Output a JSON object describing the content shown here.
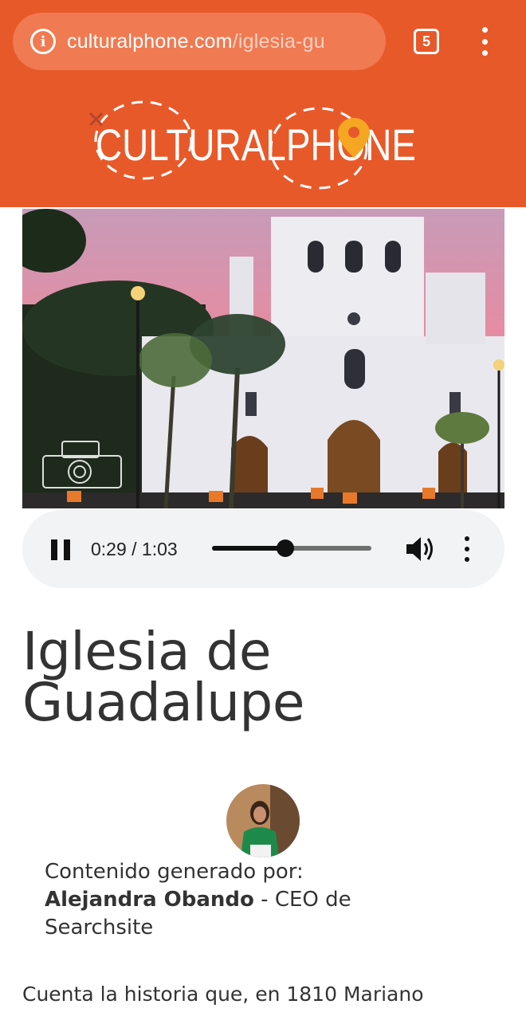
{
  "browser": {
    "url_host": "culturalphone.com",
    "url_path": "/iglesia-gu",
    "tab_count": "5"
  },
  "site": {
    "logo_text": "CULTURALPHONE",
    "brand_color": "#E8592A"
  },
  "player": {
    "time": "0:29 / 1:03",
    "progress": 0.46
  },
  "article": {
    "title": "Iglesia de Guadalupe",
    "author_prefix": "Contenido generado por:",
    "author_name": "Alejandra Obando",
    "author_role": " - CEO de Searchsite",
    "body_start": "Cuenta la historia que, en 1810 Mariano"
  },
  "icons": {
    "info": "info-circle-icon",
    "tabs": "tab-switcher-icon",
    "menu": "vertical-dots-icon",
    "pause": "pause-icon",
    "volume": "volume-icon"
  }
}
